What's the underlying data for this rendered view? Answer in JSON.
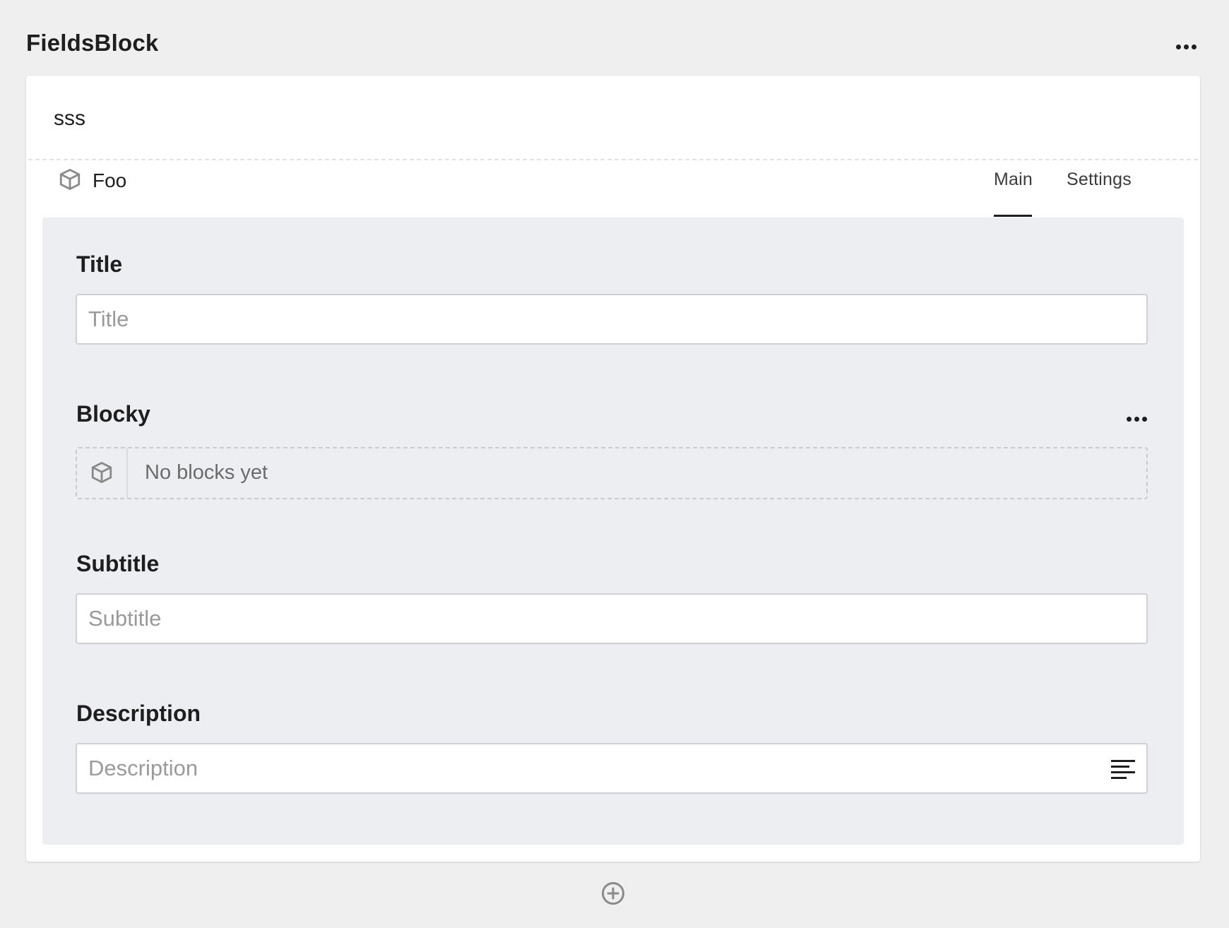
{
  "header": {
    "title": "FieldsBlock",
    "more_icon": "more-horizontal-icon"
  },
  "card": {
    "name": "sss",
    "block": {
      "icon": "cube-icon",
      "title": "Foo",
      "tabs": [
        {
          "label": "Main",
          "active": true
        },
        {
          "label": "Settings",
          "active": false
        }
      ]
    },
    "fields": {
      "title": {
        "label": "Title",
        "placeholder": "Title",
        "value": ""
      },
      "blocky": {
        "label": "Blocky",
        "more_icon": "more-horizontal-icon",
        "empty_icon": "cube-icon",
        "empty_text": "No blocks yet"
      },
      "subtitle": {
        "label": "Subtitle",
        "placeholder": "Subtitle",
        "value": ""
      },
      "description": {
        "label": "Description",
        "placeholder": "Description",
        "value": "",
        "format_icon": "align-left-icon"
      }
    }
  },
  "add_block_icon": "plus-circle-icon",
  "colors": {
    "page_background": "#efefef",
    "card_background": "#ffffff",
    "panel_background": "#edeef1",
    "text": "#1e1e1e",
    "placeholder": "#9a9a9a",
    "icon_gray": "#8a8a8a"
  }
}
